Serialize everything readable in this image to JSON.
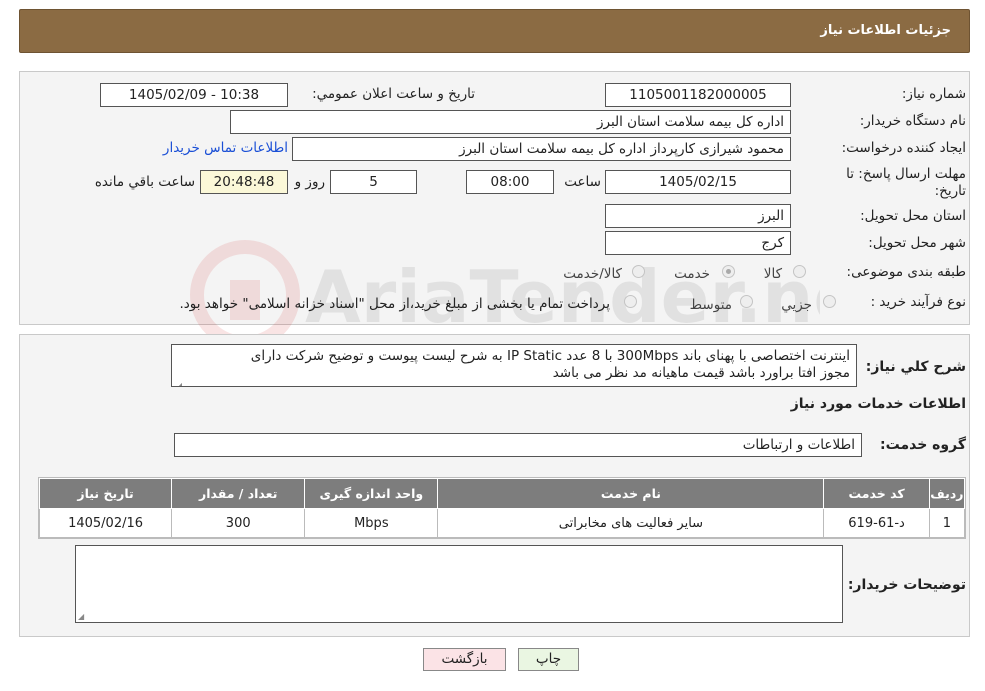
{
  "header": {
    "title": "جزئیات اطلاعات نیاز"
  },
  "form": {
    "need_number_label": "شماره نیاز:",
    "need_number": "1105001182000005",
    "announce_label": "تاریخ و ساعت اعلان عمومي:",
    "announce_value": "1405/02/09 - 10:38",
    "buyer_org_label": "نام دستگاه خريدار:",
    "buyer_org": "اداره کل بیمه سلامت استان البرز",
    "creator_label": "ايجاد کننده درخواست:",
    "creator": "محمود شیرازی کارپرداز اداره کل بیمه سلامت استان البرز",
    "contact_link": "اطلاعات تماس خريدار",
    "deadline_label_1": "مهلت ارسال پاسخ: تا",
    "deadline_label_2": "تاريخ:",
    "deadline_date": "1405/02/15",
    "time_label": "ساعت",
    "deadline_time": "08:00",
    "days": "5",
    "days_label": "روز و",
    "remaining_time": "20:48:48",
    "remaining_label": "ساعت باقي مانده",
    "province_label": "استان محل تحويل:",
    "province": "البرز",
    "city_label": "شهر محل تحويل:",
    "city": "کرج",
    "category_label": "طبقه بندی موضوعی:",
    "category_options": [
      "کالا",
      "خدمت",
      "کالا/خدمت"
    ],
    "category_selected": "خدمت",
    "purchase_type_label": "نوع فرآيند خريد :",
    "purchase_options": [
      "جزيي",
      "متوسط"
    ],
    "purchase_note": "پرداخت تمام یا بخشی از مبلغ خرید،از محل \"اسناد خزانه اسلامی\" خواهد بود."
  },
  "details": {
    "summary_label": "شرح کلي نياز:",
    "summary_line1": "اینترنت اختصاصی با پهنای باند 300Mbps با 8 عدد IP Static   به شرح لیست پیوست و توضیح شرکت دارای",
    "summary_line2": "مجوز افتا  براورد باشد قیمت ماهیانه مد نظر می باشد",
    "services_heading": "اطلاعات خدمات مورد نياز",
    "service_group_label": "گروه خدمت:",
    "service_group": "اطلاعات و ارتباطات",
    "table": {
      "headers": [
        "رديف",
        "کد خدمت",
        "نام خدمت",
        "واحد اندازه گيری",
        "تعداد / مقدار",
        "تاريخ نياز"
      ],
      "rows": [
        [
          "1",
          "د-61-619",
          "سایر فعالیت های مخابراتی",
          "Mbps",
          "300",
          "1405/02/16"
        ]
      ]
    },
    "buyer_notes_label": "توضيحات خريدار:",
    "buyer_notes": ""
  },
  "buttons": {
    "print": "چاپ",
    "back": "بازگشت"
  },
  "watermark_text": "AriaTender.neT",
  "colors": {
    "header": "#8b6b43",
    "table_header": "#7d7d7d",
    "link": "#1a4fd6"
  }
}
